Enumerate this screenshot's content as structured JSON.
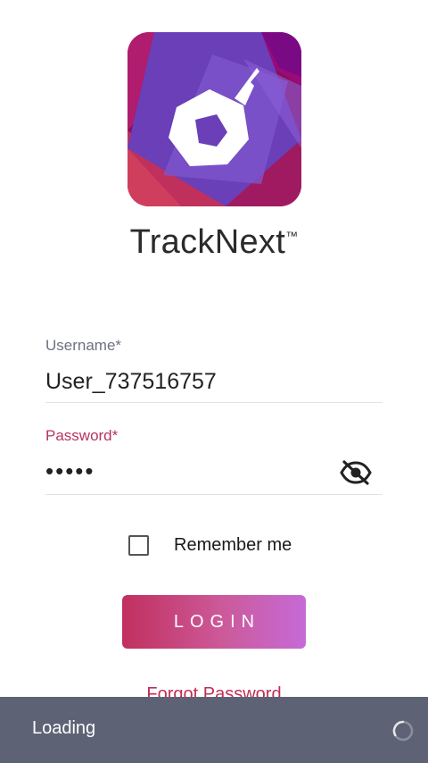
{
  "app": {
    "name": "TrackNext",
    "trademark": "™"
  },
  "form": {
    "username_label": "Username*",
    "username_value": "User_737516757",
    "password_label": "Password*",
    "password_value": "•••••",
    "remember_label": "Remember me",
    "remember_checked": false,
    "login_label": "LOGIN",
    "forgot_label": "Forgot Password"
  },
  "snackbar": {
    "text": "Loading"
  },
  "icons": {
    "visibility_toggle": "eye-off-icon",
    "spinner": "spinner-icon",
    "logo": "app-logo"
  },
  "colors": {
    "accent": "#c22c57",
    "button_start": "#c1305e",
    "button_end": "#c66ad8",
    "snackbar_bg": "#5d6375"
  }
}
